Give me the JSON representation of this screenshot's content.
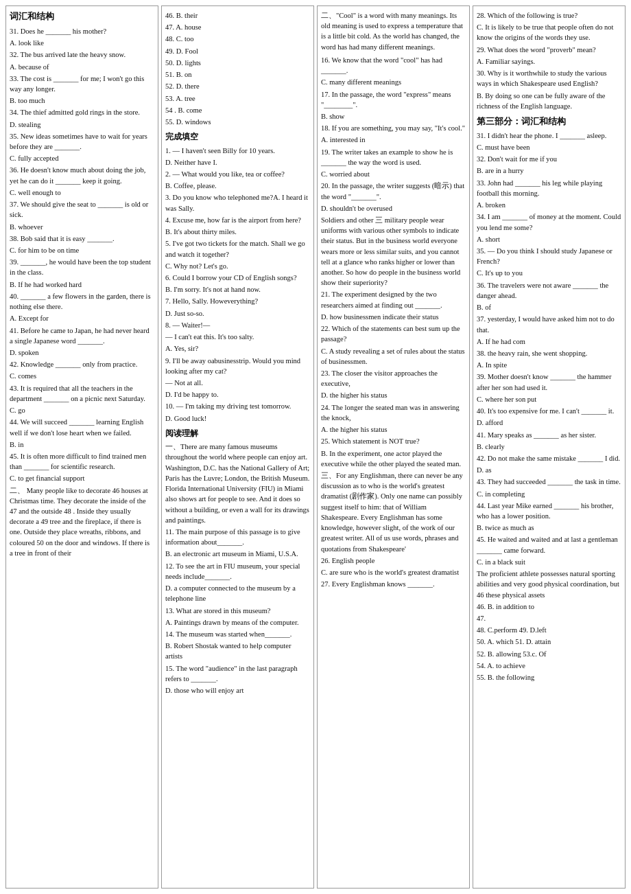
{
  "col1": {
    "title": "词汇和结构",
    "content": [
      "31. Does he _______ his mother?",
      "    A. look like",
      "32. The bus arrived late the heavy snow.",
      "    A. because of",
      "33. The cost is _______ for me; I won't go this way any longer.",
      "    B. too much",
      "34. The thief admitted gold rings in the store.",
      "    D. stealing",
      "35. New ideas sometimes have to wait for years before they are _______.",
      "    C. fully accepted",
      "36. He doesn't know much about doing the job, yet he can do it _______ keep it going.",
      "    C. well enough to",
      "37. We should give the seat to _______ is old or sick.",
      "    B. whoever",
      "38. Bob said that it is easy _______.",
      "    C. for him to be on time",
      "39. _______, he would have been the top student in the class.",
      "    B. If he had worked hard",
      "40. _______ a few flowers in the garden, there is nothing else there.",
      "    A. Except for",
      "41. Before he came to Japan, he had never heard a single Japanese word _______.",
      "    D. spoken",
      "42. Knowledge _______ only from practice.",
      "    C. comes",
      "43. It is required that all the teachers in the department _______ on a picnic next Saturday.",
      "    C. go",
      "44. We will succeed _______ learning English well if we don't lose heart when we failed.",
      "    B. in",
      "45. It is often more difficult to find trained men than _______ for scientific research.",
      "    C. to get financial support",
      "二、  Many people like to decorate 46 houses at Christmas time. They decorate the inside of the 47 and the outside 48 . Inside they usually decorate a 49 tree and the fireplace, if there is one. Outside they place wreaths, ribbons, and coloured 50 on the door and windows. If there is a tree in front of their"
    ]
  },
  "col2": {
    "items": [
      "46.  B. their",
      "47. A. house",
      "48. C. too",
      "49. D. Fool",
      "50.   D. lights",
      "51.   B. on",
      "52.   D. there",
      "53. A. tree",
      "54 . B. come",
      "55. D. windows"
    ],
    "section1": "完成填空",
    "dialog": [
      "1. — I haven't seen Billy for 10 years.",
      "   D. Neither have I.",
      "2. — What would you like, tea or coffee?",
      "   B. Coffee, please.",
      "3. Do you know who telephoned me?A. I heard it was Sally.",
      "4. Excuse me, how far is the airport from here?",
      "   B. It's about thirty miles.",
      "5. I've got two tickets for the match. Shall we go and watch it together?",
      "   C. Why not? Let's go.",
      "6. Could I borrow your CD of English songs?",
      "   B. I'm sorry. It's not at hand now.",
      "7. Hello, Sally. Howeverything?",
      "   D. Just so-so.",
      "8.  — Waiter!—",
      "   — I can't eat this. It's too salty.",
      "   A. Yes, sir?",
      "9. I'll be away oabusinesstrip. Would you mind looking after my cat?",
      "   — Not at all.",
      "   D. I'd be happy to.",
      "10. — I'm taking my driving test tomorrow.",
      "    D. Good luck!"
    ],
    "section2": "阅读理解",
    "reading1": [
      "一、There are many famous museums throughout the world where people can enjoy art. Washington, D.C. has the National Gallery of Art; Paris has the Luvre; London, the British Museum. Florida International University (FIU) in Miami also shows art for people to see. And it does so without a building, or even a wall for its drawings and paintings.",
      "11. The main purpose of this passage is to give information about_______.",
      "    B. an electronic art museum in Miami, U.S.A.",
      "12. To see the art in FIU museum, your special needs include_______.",
      "    D. a computer connected to the museum by a telephone line",
      "13. What are stored in this museum?",
      "    A. Paintings drawn by means of the computer.",
      "14. The museum was started when_______.",
      "    B. Robert Shostak wanted to help computer artists",
      "15. The word \"audience\" in the last paragraph refers to _______.",
      "    D. those who will enjoy art"
    ]
  },
  "col3": {
    "intro": "二、\"Cool\" is a word with many meanings. Its old meaning is used to express a temperature that is a little bit cold. As the world has changed, the word has had many different meanings.",
    "items": [
      "16. We know that the word \"cool\" has had _______.",
      "    C. many different meanings",
      "17. In the passage, the word \"express\" means \"________\".",
      "    B. show",
      "18. If you are something, you may say, \"It's cool.\"",
      "    A. interested in",
      "19. The writer takes an example to show he is _______ the way the word is used.",
      "    C. worried about",
      "20. In the passage, the writer suggests (暗示) that the word \"_______\".",
      "    D. shouldn't be overused",
      "Soldiers and other 三 military people wear uniforms with various other symbols to indicate their status. But in the business world everyone wears more or less similar suits, and you cannot tell at a glance who ranks higher or lower than another. So how do people in the business world show their superiority?",
      "21. The experiment designed by the two researchers aimed at finding out _______.",
      "    D. how businessmen indicate their status",
      "22. Which of the statements can best sum up the passage?",
      "    C. A study revealing a set of rules about the status of businessmen.",
      "23. The closer the visitor approaches the executive,",
      "    D. the higher his status",
      "24. The longer the seated man was in answering the knock,",
      "    A. the higher his status",
      "25. Which statement is NOT true?",
      "    B. In the experiment, one actor played the executive while the other played the seated man.",
      "三、For any Englishman, there can never be any discussion as to who is the world's greatest dramatist (剧作家). Only one name can possibly suggest itself to him: that of William Shakespeare. Every Englishman has some knowledge, however slight, of the work of our greatest writer. All of us use words, phrases and quotations from Shakespeare'",
      "26. English people",
      "    C. are sure who is the world's greatest dramatist",
      "27. Every Englishman knows _______."
    ]
  },
  "col4": {
    "items": [
      "28. Which of the following is true?",
      "    C. It is likely to be true that people often do not know the origins of the words they use.",
      "29. What does the word \"proverb\" mean?",
      "    A. Familiar sayings.",
      "30. Why is it worthwhile to study the various ways in which Shakespeare used English?",
      "    B. By doing so one can be fully aware of the richness of the English language."
    ],
    "section": "第三部分：词汇和结构",
    "vocab": [
      "31. I didn't hear the phone. I _______ asleep.",
      "    C. must have been",
      "32. Don't wait for me if you",
      "    B. are in a hurry",
      "33. John had _______ his leg while playing football this morning.",
      "    A. broken",
      "34. I am _______ of money at the moment. Could you lend me some?",
      "    A. short",
      "35. — Do you think I should study Japanese or French?",
      "    C. It's up to you",
      "36. The travelers were not aware _______ the danger ahead.",
      "    B. of",
      "37. yesterday, I would have asked him not to do that.",
      "    A. If he had com",
      "38. the heavy rain, she went shopping.",
      "    A. In spite",
      "39. Mother doesn't know _______ the hammer after her son had used it.",
      "    C. where her son put",
      "40. It's too expensive for me. I can't _______ it.",
      "    D. afford",
      "41. Mary speaks as _______ as her sister.",
      "    B. clearly",
      "42. Do not make the same mistake _______ I did.",
      "    D. as",
      "43. They had succeeded _______ the task in time.",
      "    C. in completing",
      "44. Last year Mike earned _______ his brother, who has a lower position.",
      "    B. twice as much as",
      "45. He waited and waited and at last a gentleman _______ came forward.",
      "    C. in a black suit",
      "The proficient athlete possesses natural sporting abilities and very good physical coordination, but 46 these physical assets",
      "46. B. in addition to",
      "47.",
      "48. C.perform  49. D.left",
      "50. A. which 51. D. attain",
      "52.  B. allowing  53.c. Of",
      "   54.  A.  to achieve",
      "55.  B. the following"
    ]
  }
}
